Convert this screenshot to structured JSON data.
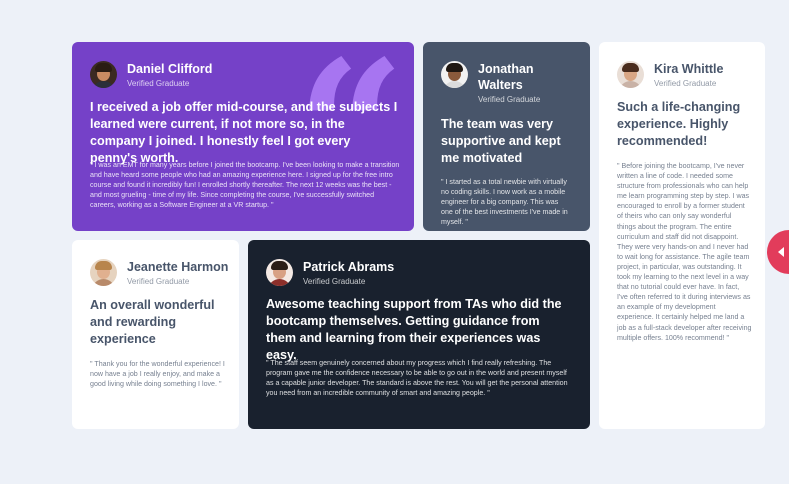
{
  "testimonials": [
    {
      "name": "Daniel Clifford",
      "role": "Verified Graduate",
      "headline": "I received a job offer mid-course, and the subjects I learned were current, if not more so, in the company I joined. I honestly feel I got every penny's worth.",
      "body": "\" I was an EMT for many years before I joined the bootcamp. I've been looking to make a transition and have heard some people who had an amazing experience here. I signed up for the free intro course and found it incredibly fun! I enrolled shortly thereafter. The next 12 weeks was the best - and most grueling - time of my life. Since completing the course, I've successfully switched careers, working as a Software Engineer at a VR startup. \"",
      "bg": "#7541c8"
    },
    {
      "name": "Jonathan Walters",
      "role": "Verified Graduate",
      "headline": "The team was very supportive and kept me motivated",
      "body": "\" I started as a total newbie with virtually no coding skills. I now work as a mobile engineer for a big company. This was one of the best investments I've made in myself. \"",
      "bg": "#48556a"
    },
    {
      "name": "Kira Whittle",
      "role": "Verified Graduate",
      "headline": "Such a life-changing experience. Highly recommended!",
      "body": "\" Before joining the bootcamp, I've never written a line of code. I needed some structure from professionals who can help me learn programming step by step. I was encouraged to enroll by a former student of theirs who can only say wonderful things about the program. The entire curriculum and staff did not disappoint. They were very hands-on and I never had to wait long for assistance. The agile team project, in particular, was outstanding. It took my learning to the next level in a way that no tutorial could ever have. In fact, I've often referred to it during interviews as an example of my development experience. It certainly helped me land a job as a full-stack developer after receiving multiple offers. 100% recommend! \"",
      "bg": "#ffffff"
    },
    {
      "name": "Jeanette Harmon",
      "role": "Verified Graduate",
      "headline": "An overall wonderful and rewarding experience",
      "body": "\" Thank you for the wonderful experience! I now have a job I really enjoy, and make a good living while doing something I love. \"",
      "bg": "#ffffff"
    },
    {
      "name": "Patrick Abrams",
      "role": "Verified Graduate",
      "headline": "Awesome teaching support from TAs who did the bootcamp themselves. Getting guidance from them and learning from their experiences was easy.",
      "body": "\" The staff seem genuinely concerned about my progress which I find really refreshing. The program gave me the confidence necessary to be able to go out in the world and present myself as a capable junior developer. The standard is above the rest. You will get the personal attention you need from an incredible community of smart and amazing people. \"",
      "bg": "#19212e"
    }
  ],
  "icons": {
    "quote": "quote-icon",
    "side_button": "chevron-left-icon"
  },
  "colors": {
    "page_bg": "#edf1f8",
    "accent": "#e23c5b"
  }
}
